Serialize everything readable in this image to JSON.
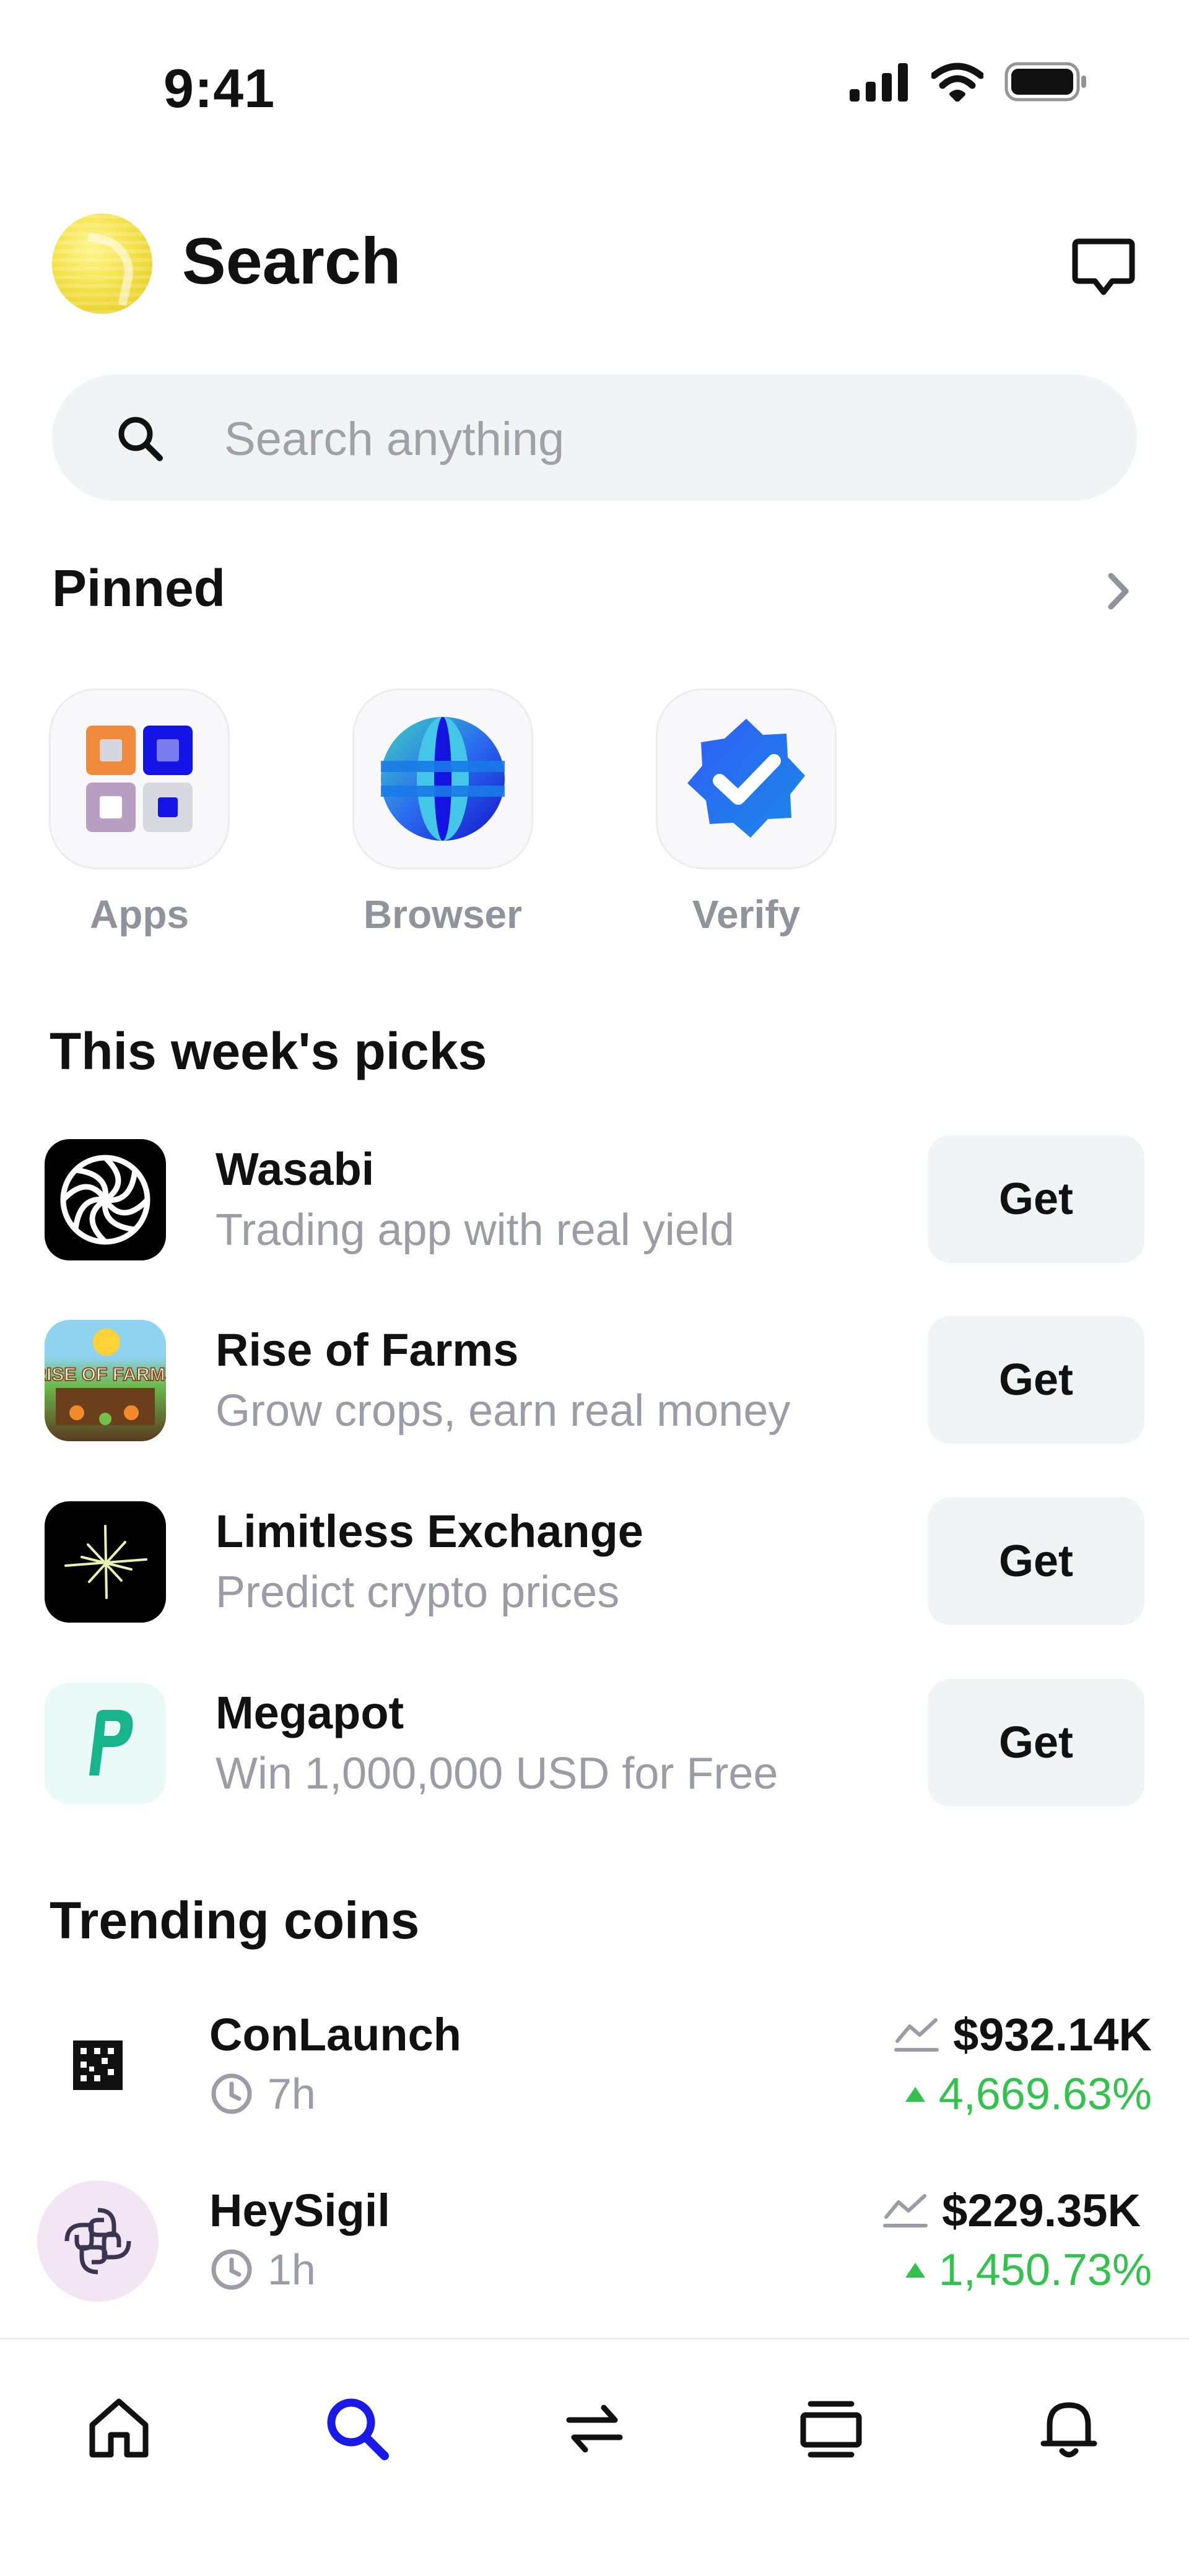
{
  "status_bar": {
    "time": "9:41"
  },
  "header": {
    "title": "Search"
  },
  "search": {
    "placeholder": "Search anything"
  },
  "pinned": {
    "title": "Pinned",
    "items": [
      {
        "label": "Apps",
        "icon": "apps-grid-icon"
      },
      {
        "label": "Browser",
        "icon": "globe-icon"
      },
      {
        "label": "Verify",
        "icon": "verified-badge-icon"
      }
    ]
  },
  "picks": {
    "title": "This week's picks",
    "items": [
      {
        "name": "Wasabi",
        "description": "Trading app with real yield",
        "button": "Get",
        "icon": "wasabi-logo"
      },
      {
        "name": "Rise of Farms",
        "description": "Grow crops, earn real money",
        "button": "Get",
        "icon": "rise-of-farms-logo",
        "logo_text": "RISE OF FARMS"
      },
      {
        "name": "Limitless Exchange",
        "description": "Predict crypto prices",
        "button": "Get",
        "icon": "limitless-logo"
      },
      {
        "name": "Megapot",
        "description": "Win 1,000,000 USD for Free",
        "button": "Get",
        "icon": "megapot-logo"
      }
    ]
  },
  "trending": {
    "title": "Trending coins",
    "items": [
      {
        "name": "ConLaunch",
        "age": "7h",
        "market_cap": "$932.14K",
        "change": "4,669.63%",
        "direction": "up",
        "icon": "conlaunch-logo"
      },
      {
        "name": "HeySigil",
        "age": "1h",
        "market_cap": "$229.35K",
        "change": "1,450.73%",
        "direction": "up",
        "icon": "heysigil-logo"
      }
    ]
  },
  "tabbar": {
    "items": [
      {
        "icon": "home-icon",
        "active": false
      },
      {
        "icon": "search-icon",
        "active": true
      },
      {
        "icon": "swap-icon",
        "active": false
      },
      {
        "icon": "cards-icon",
        "active": false
      },
      {
        "icon": "bell-icon",
        "active": false
      }
    ]
  },
  "colors": {
    "accent": "#1a1ae6",
    "positive": "#33c24d",
    "muted_text": "#9a9da5",
    "surface": "#f2f3f5"
  }
}
